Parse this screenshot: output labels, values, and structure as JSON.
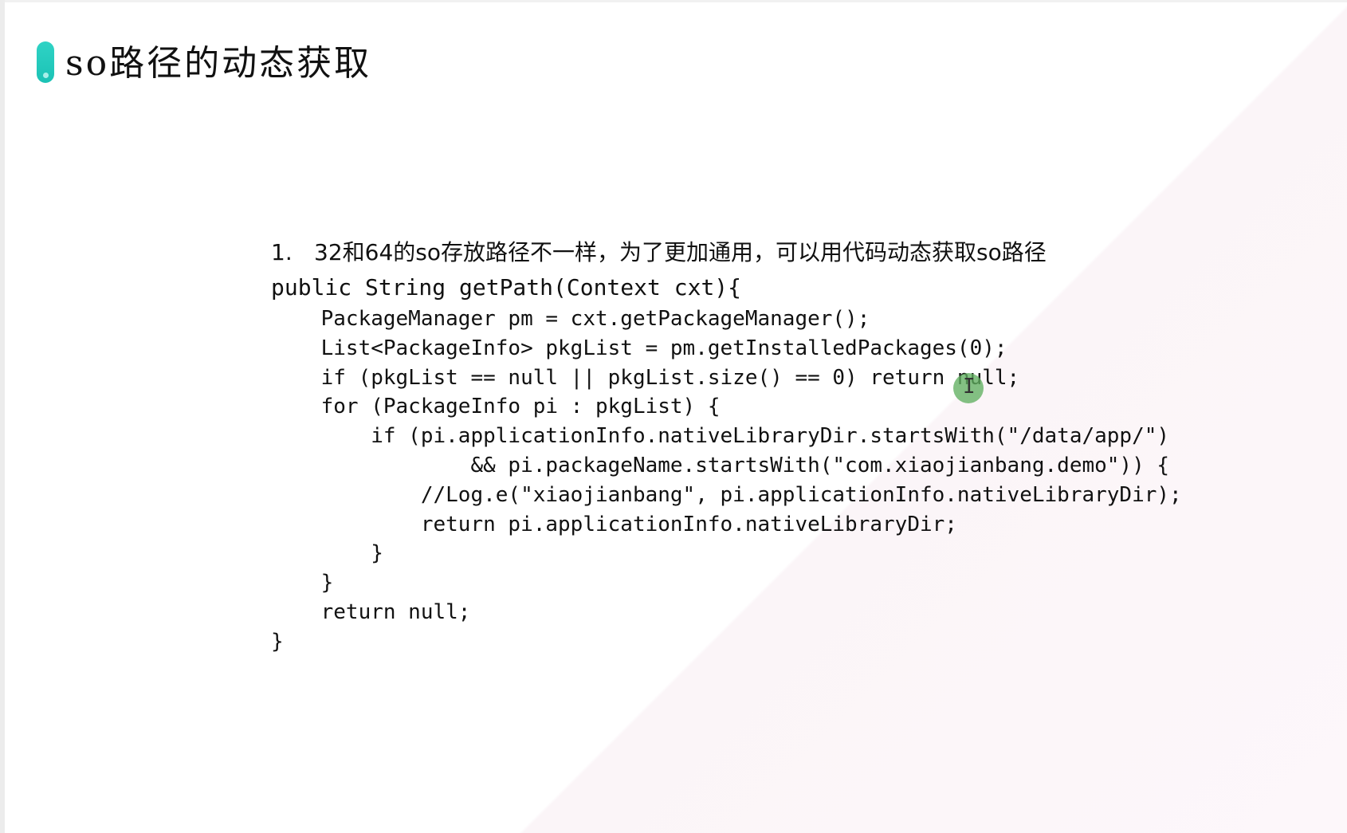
{
  "slide": {
    "title": "so路径的动态获取",
    "accent_color": "#1fc6b8",
    "cursor_icon": "text-cursor-icon",
    "cursor_highlight_color": "#60b060"
  },
  "content": {
    "bullet": {
      "number": "1.",
      "text": "32和64的so存放路径不一样，为了更加通用，可以用代码动态获取so路径"
    },
    "code_lines": [
      "public String getPath(Context cxt){",
      "    PackageManager pm = cxt.getPackageManager();",
      "    List<PackageInfo> pkgList = pm.getInstalledPackages(0);",
      "    if (pkgList == null || pkgList.size() == 0) return null;",
      "    for (PackageInfo pi : pkgList) {",
      "        if (pi.applicationInfo.nativeLibraryDir.startsWith(\"/data/app/\")",
      "                && pi.packageName.startsWith(\"com.xiaojianbang.demo\")) {",
      "            //Log.e(\"xiaojianbang\", pi.applicationInfo.nativeLibraryDir);",
      "            return pi.applicationInfo.nativeLibraryDir;",
      "        }",
      "    }",
      "    return null;",
      "}"
    ]
  }
}
